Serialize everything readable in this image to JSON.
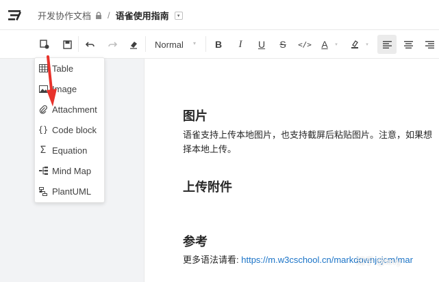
{
  "header": {
    "workspace": "开发协作文档",
    "separator": "/",
    "document_title": "语雀使用指南",
    "dropdown_glyph": "▾"
  },
  "toolbar": {
    "paragraph_style": "Normal",
    "caret": "▾",
    "bold": "B",
    "italic": "I",
    "underline": "U",
    "strike": "S",
    "code": "</>",
    "font_color": "A",
    "items": [
      "insert-icon",
      "save-icon",
      "undo-icon",
      "redo-icon",
      "eraser-icon",
      "bold-icon",
      "italic-icon",
      "underline-icon",
      "strikethrough-icon",
      "code-icon",
      "font-color-icon",
      "highlight-icon",
      "align-left-icon",
      "align-center-icon",
      "align-right-icon"
    ]
  },
  "insert_menu": {
    "items": [
      {
        "label": "Table",
        "icon": "table-icon"
      },
      {
        "label": "Image",
        "icon": "image-icon"
      },
      {
        "label": "Attachment",
        "icon": "paperclip-icon"
      },
      {
        "label": "Code block",
        "icon": "braces-icon",
        "glyph": "{}"
      },
      {
        "label": "Equation",
        "icon": "sigma-icon",
        "glyph": "Σ"
      },
      {
        "label": "Mind Map",
        "icon": "mindmap-icon"
      },
      {
        "label": "PlantUML",
        "icon": "plantuml-icon"
      }
    ]
  },
  "document": {
    "sections": [
      {
        "heading": "图片",
        "lines": [
          "语雀支持上传本地图片，也支持截屏后粘贴图片。注意，如果想",
          "择本地上传。"
        ]
      },
      {
        "heading": "上传附件",
        "lines": []
      },
      {
        "heading": "参考",
        "lines": []
      }
    ],
    "reference_prefix": "更多语法请看: ",
    "reference_link": "https://m.w3cschool.cn/markdownjcjcm/mar"
  },
  "watermark": "知乎 @levy",
  "colors": {
    "accent_arrow": "#e8322b",
    "link": "#1a73c7"
  }
}
